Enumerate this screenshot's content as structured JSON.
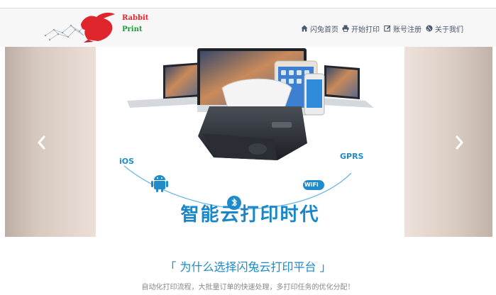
{
  "brand": {
    "line1": "Rabbit",
    "line2": "Print"
  },
  "nav": [
    {
      "label": "闪兔首页",
      "icon": "home-icon"
    },
    {
      "label": "开始打印",
      "icon": "printer-icon"
    },
    {
      "label": "账号注册",
      "icon": "edit-icon"
    },
    {
      "label": "关于我们",
      "icon": "globe-icon"
    }
  ],
  "banner": {
    "slogan": "智能云打印时代",
    "labels": {
      "ios": "iOS",
      "gprs": "GPRS",
      "wifi": "WiFi"
    },
    "prev_icon": "chevron-left-icon",
    "next_icon": "chevron-right-icon"
  },
  "section": {
    "title": "「 为什么选择闪兔云打印平台 」",
    "subtitle": "自动化打印流程，大批量订单的快速处理，多打印任务的优化分配！"
  },
  "colors": {
    "accent": "#1a8ac8",
    "nav_text": "#4a5a6e",
    "logo_red": "#e3262d",
    "logo_green": "#1f9a38"
  }
}
